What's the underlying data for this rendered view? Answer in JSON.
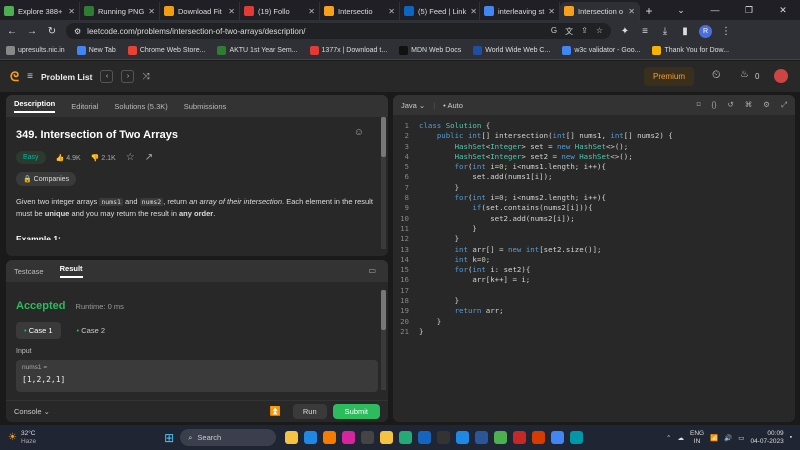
{
  "browser": {
    "tabs": [
      {
        "label": "Explore 388+",
        "icon": "dx-icon",
        "color": "#4caf50",
        "active": false
      },
      {
        "label": "Running PNG",
        "icon": "globe-icon",
        "color": "#2e7d32",
        "active": false
      },
      {
        "label": "Download Fit",
        "icon": "download-site-icon",
        "color": "#f39c12",
        "active": false
      },
      {
        "label": "(19) Follo",
        "icon": "youtube-icon",
        "color": "#e53935",
        "active": false
      },
      {
        "label": "Intersectio",
        "icon": "leetcode-icon",
        "color": "#f89f1b",
        "active": false
      },
      {
        "label": "(5) Feed | Link",
        "icon": "linkedin-icon",
        "color": "#0a66c2",
        "active": false
      },
      {
        "label": "interleaving st",
        "icon": "google-icon",
        "color": "#4285f4",
        "active": false
      },
      {
        "label": "Intersection o",
        "icon": "leetcode-icon",
        "color": "#f89f1b",
        "active": true
      }
    ],
    "url": "leetcode.com/problems/intersection-of-two-arrays/description/",
    "profile_initial": "R",
    "bookmarks": [
      {
        "label": "upresults.nic.in",
        "color": "#888"
      },
      {
        "label": "New Tab",
        "color": "#4285f4"
      },
      {
        "label": "Chrome Web Store...",
        "color": "#e94235"
      },
      {
        "label": "AKTU 1st Year Sem...",
        "color": "#2e7d32"
      },
      {
        "label": "1377x | Download t...",
        "color": "#e53935"
      },
      {
        "label": "MDN Web Docs",
        "color": "#111"
      },
      {
        "label": "World Wide Web C...",
        "color": "#1e4fa3"
      },
      {
        "label": "w3c validator - Goo...",
        "color": "#4285f4"
      },
      {
        "label": "Thank You for Dow...",
        "color": "#f5b400"
      }
    ]
  },
  "lc": {
    "problem_list": "Problem List",
    "premium": "Premium",
    "streak": "0",
    "desc_tabs": [
      "Description",
      "Editorial",
      "Solutions (5.3K)",
      "Submissions"
    ],
    "title": "349. Intersection of Two Arrays",
    "difficulty": "Easy",
    "likes": "4.9K",
    "dislikes": "2.1K",
    "companies": "Companies",
    "text_1": "Given two integer arrays ",
    "code_1": "nums1",
    "text_2": " and ",
    "code_2": "nums2",
    "text_3": ", return ",
    "em_1": "an array of their intersection",
    "text_4": ". Each element in the result must be ",
    "b_1": "unique",
    "text_5": " and you may return the result in ",
    "b_2": "any order",
    "text_6": ".",
    "example_heading": "Example 1:",
    "result_tabs": [
      "Testcase",
      "Result"
    ],
    "accepted": "Accepted",
    "runtime": "Runtime: 0 ms",
    "case1": "Case 1",
    "case2": "Case 2",
    "input_label": "Input",
    "nums1_label": "nums1 =",
    "nums1_value": "[1,2,2,1]",
    "console": "Console",
    "run": "Run",
    "submit": "Submit",
    "lang": "Java",
    "auto": "Auto",
    "code_lines": [
      "class Solution {",
      "    public int[] intersection(int[] nums1, int[] nums2) {",
      "        HashSet<Integer> set = new HashSet<>();",
      "        HashSet<Integer> set2 = new HashSet<>();",
      "        for(int i=0; i<nums1.length; i++){",
      "            set.add(nums1[i]);",
      "        }",
      "        for(int i=0; i<nums2.length; i++){",
      "            if(set.contains(nums2[i])){",
      "                set2.add(nums2[i]);",
      "            }",
      "        }",
      "        int arr[] = new int[set2.size()];",
      "        int k=0;",
      "        for(int i: set2){",
      "            arr[k++] = i;",
      "",
      "        }",
      "        return arr;",
      "    }",
      "}"
    ]
  },
  "taskbar": {
    "temp": "32°C",
    "weather": "Haze",
    "search": "Search",
    "lang1": "ENG",
    "lang2": "IN",
    "time": "00:09",
    "date": "04-07-2023"
  }
}
